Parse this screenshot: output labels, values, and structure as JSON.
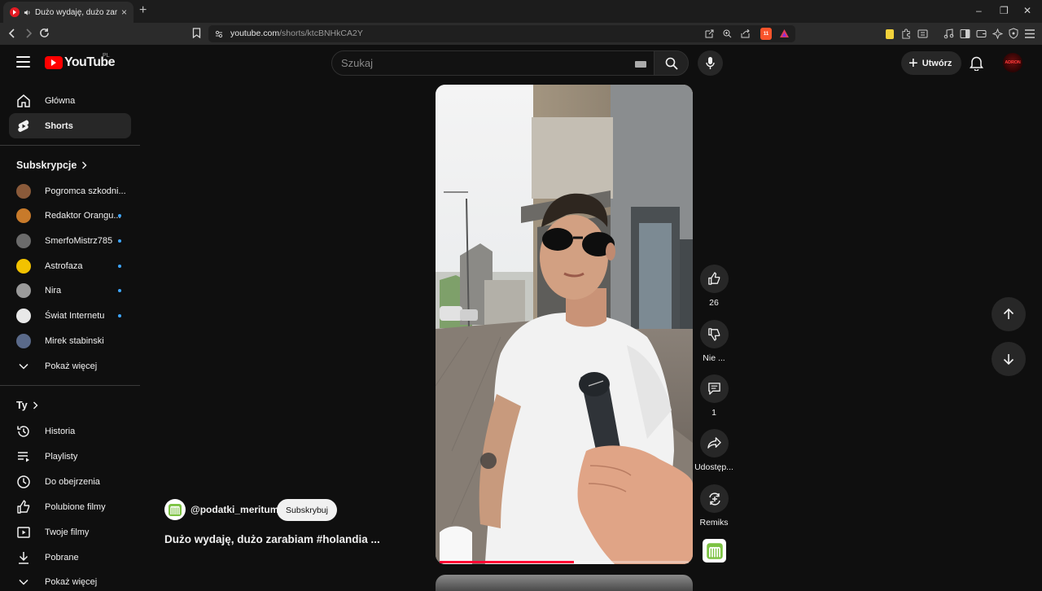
{
  "browser": {
    "tab_title": "Dużo wydaję, dużo zarabiam",
    "tab_close": "×",
    "new_tab": "+",
    "url_host": "youtube.com",
    "url_path": "/shorts/ktcBNHkCA2Y",
    "window_controls": [
      "–",
      "❐",
      "✕"
    ],
    "brave_badge": "11"
  },
  "header": {
    "logo_text": "YouTube",
    "country_code": "PL",
    "search_placeholder": "Szukaj",
    "create_label": "Utwórz",
    "avatar_text": "ADRON"
  },
  "sidebar": {
    "main": [
      {
        "label": "Główna",
        "icon": "home-icon"
      },
      {
        "label": "Shorts",
        "icon": "shorts-icon",
        "active": true
      }
    ],
    "subscriptions_title": "Subskrypcje",
    "subscriptions": [
      {
        "label": "Pogromca szkodni...",
        "color": "#8a5a3a",
        "live": false
      },
      {
        "label": "Redaktor Orangu...",
        "color": "#c87a2a",
        "live": true
      },
      {
        "label": "SmerfoMistrz785",
        "color": "#6b6b6b",
        "live": true
      },
      {
        "label": "Astrofaza",
        "color": "#f2c200",
        "live": true
      },
      {
        "label": "Nira",
        "color": "#9a9a9a",
        "live": true
      },
      {
        "label": "Świat Internetu",
        "color": "#e8e8e8",
        "live": true
      },
      {
        "label": "Mirek stabinski",
        "color": "#5a6a8a",
        "live": false
      }
    ],
    "show_more": "Pokaż więcej",
    "you_title": "Ty",
    "you_items": [
      {
        "label": "Historia",
        "icon": "history-icon"
      },
      {
        "label": "Playlisty",
        "icon": "playlist-icon"
      },
      {
        "label": "Do obejrzenia",
        "icon": "clock-icon"
      },
      {
        "label": "Polubione filmy",
        "icon": "thumbs-up-icon"
      },
      {
        "label": "Twoje filmy",
        "icon": "video-icon"
      },
      {
        "label": "Pobrane",
        "icon": "download-icon"
      }
    ],
    "show_more_2": "Pokaż więcej"
  },
  "short": {
    "channel_handle": "@podatki_meritum",
    "subscribe_label": "Subskrybuj",
    "title": "Dużo wydaję, dużo zarabiam #holandia  ...",
    "progress": 0.54,
    "mic_brand": "SENNHEISER"
  },
  "actions": {
    "like_count": "26",
    "dislike_label": "Nie ...",
    "comment_count": "1",
    "share_label": "Udostęp...",
    "remix_label": "Remiks"
  }
}
